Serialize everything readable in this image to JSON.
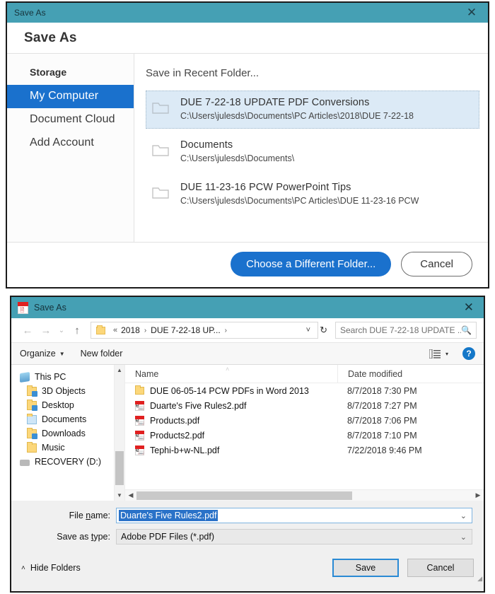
{
  "acrobat_dialog": {
    "titlebar": {
      "title": "Save As",
      "close_icon": "close-icon"
    },
    "header": "Save As",
    "sidebar": {
      "heading": "Storage",
      "items": [
        {
          "label": "My Computer",
          "selected": true
        },
        {
          "label": "Document Cloud",
          "selected": false
        },
        {
          "label": "Add Account",
          "selected": false
        }
      ]
    },
    "main": {
      "title": "Save in Recent Folder...",
      "recent_folders": [
        {
          "name": "DUE 7-22-18 UPDATE PDF Conversions",
          "path": "C:\\Users\\julesds\\Documents\\PC Articles\\2018\\DUE 7-22-18 ",
          "selected": true
        },
        {
          "name": "Documents",
          "path": "C:\\Users\\julesds\\Documents\\",
          "selected": false
        },
        {
          "name": "DUE 11-23-16 PCW PowerPoint Tips",
          "path": "C:\\Users\\julesds\\Documents\\PC Articles\\DUE 11-23-16 PCW",
          "selected": false
        }
      ]
    },
    "footer": {
      "choose_folder_label": "Choose a Different Folder...",
      "cancel_label": "Cancel"
    }
  },
  "windows_dialog": {
    "titlebar": {
      "title": "Save As",
      "app_icon": "pdf-file-icon",
      "close_icon": "close-icon"
    },
    "navbar": {
      "back_icon": "arrow-left-icon",
      "forward_icon": "arrow-right-icon",
      "recent_icon": "chevron-down-icon",
      "up_icon": "arrow-up-icon",
      "breadcrumb": {
        "overflow": "«",
        "crumbs": [
          "2018",
          "DUE 7-22-18 UP..."
        ],
        "separator": "›"
      },
      "history_caret": "˅",
      "refresh_icon": "refresh-icon",
      "search_placeholder": "Search DUE 7-22-18 UPDATE ...",
      "search_value": "",
      "search_icon": "search-icon"
    },
    "toolbar": {
      "organize_label": "Organize",
      "new_folder_label": "New folder",
      "view_icon": "list-view-icon",
      "view_caret": "▾",
      "help_label": "?"
    },
    "tree": [
      {
        "label": "This PC",
        "icon": "this-pc-icon",
        "indent": false
      },
      {
        "label": "3D Objects",
        "icon": "folder-3d-objects-icon",
        "indent": true
      },
      {
        "label": "Desktop",
        "icon": "folder-desktop-icon",
        "indent": true
      },
      {
        "label": "Documents",
        "icon": "folder-documents-icon",
        "indent": true
      },
      {
        "label": "Downloads",
        "icon": "folder-downloads-icon",
        "indent": true
      },
      {
        "label": "Music",
        "icon": "folder-music-icon",
        "indent": true
      },
      {
        "label": "RECOVERY (D:)",
        "icon": "drive-icon",
        "indent": false
      }
    ],
    "filelist": {
      "columns": [
        "Name",
        "Date modified"
      ],
      "sort_indicator": "˄",
      "rows": [
        {
          "name": "DUE 06-05-14 PCW PDFs in Word 2013",
          "date": "8/7/2018 7:30 PM",
          "type": "folder"
        },
        {
          "name": "Duarte's Five Rules2.pdf",
          "date": "8/7/2018 7:27 PM",
          "type": "pdf"
        },
        {
          "name": "Products.pdf",
          "date": "8/7/2018 7:06 PM",
          "type": "pdf"
        },
        {
          "name": "Products2.pdf",
          "date": "8/7/2018 7:10 PM",
          "type": "pdf"
        },
        {
          "name": "Tephi-b+w-NL.pdf",
          "date": "7/22/2018 9:46 PM",
          "type": "pdf"
        }
      ]
    },
    "fields": {
      "file_name_label_pre": "File ",
      "file_name_label_key": "n",
      "file_name_label_post": "ame:",
      "file_name_value": "Duarte's Five Rules2.pdf",
      "save_type_label_pre": "Save as ",
      "save_type_label_key": "t",
      "save_type_label_post": "ype:",
      "save_type_value": "Adobe PDF Files (*.pdf)"
    },
    "footer": {
      "hide_folders_label": "Hide Folders",
      "hide_folders_caret": "˄",
      "save_label_pre": "",
      "save_label": "Save",
      "cancel_label": "Cancel"
    }
  },
  "colors": {
    "titlebar_teal": "#45a0b4",
    "accent_blue": "#1a71cd",
    "selection_blue": "#2a72c8"
  }
}
